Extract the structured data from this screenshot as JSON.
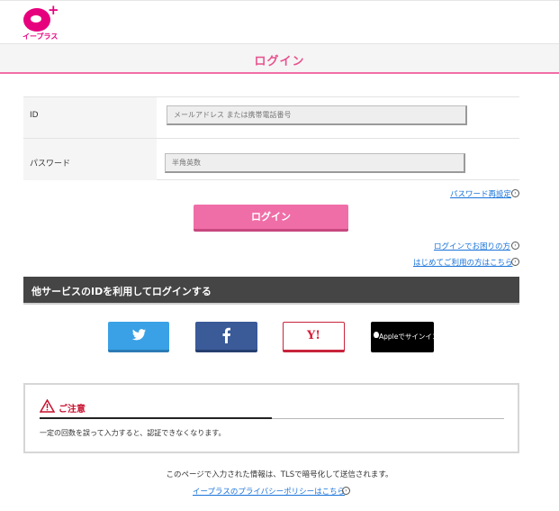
{
  "header": {
    "logo_text": "イープラス",
    "logo_plus": "+",
    "title": "ログイン"
  },
  "form": {
    "id_label": "ID",
    "id_placeholder": "メールアドレス または携帯電話番号",
    "password_label": "パスワード",
    "password_placeholder": "半角英数",
    "password_reset_link": "パスワード再設定",
    "login_button": "ログイン",
    "trouble_link": "ログインでお困りの方",
    "first_time_link": "はじめてご利用の方はこちら"
  },
  "sns": {
    "heading": "他サービスのIDを利用してログインする",
    "yahoo_label": "Y!",
    "apple_label": "Appleでサインイン",
    "colors": {
      "twitter": "#3aa1e6",
      "facebook": "#3a5a98",
      "yahoo": "#d81e3a",
      "apple": "#000000"
    }
  },
  "notice": {
    "title": "ご注意",
    "text": "一定の回数を誤って入力すると、認証できなくなります。"
  },
  "footer": {
    "tls_text": "このページで入力された情報は、TLSで暗号化して送信されます。",
    "privacy_link": "イープラスのプライバシーポリシーはこちら"
  },
  "colors": {
    "brand": "#e6007e",
    "accent": "#f06ea8",
    "link": "#1a73d9",
    "warning": "#c8102e"
  }
}
